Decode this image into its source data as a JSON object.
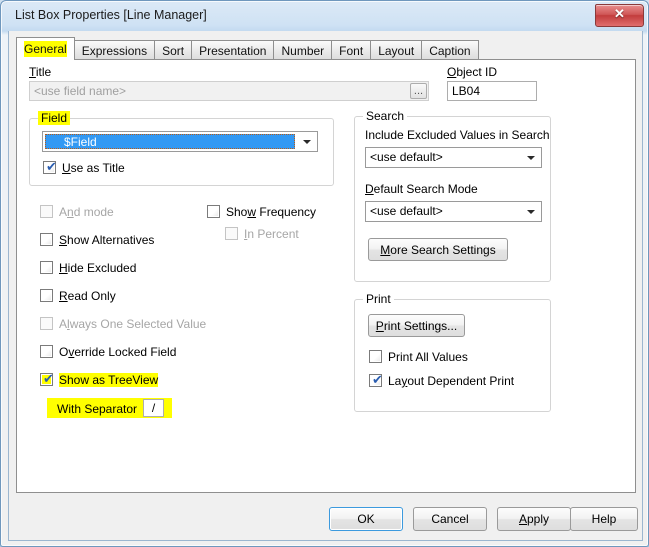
{
  "window": {
    "title": "List Box Properties [Line Manager]",
    "close_label": "✕",
    "close_icon": "close-icon"
  },
  "tabs": [
    {
      "label": "General",
      "active": true,
      "highlighted": true
    },
    {
      "label": "Expressions",
      "active": false,
      "highlighted": false
    },
    {
      "label": "Sort",
      "active": false,
      "highlighted": false
    },
    {
      "label": "Presentation",
      "active": false,
      "highlighted": false
    },
    {
      "label": "Number",
      "active": false,
      "highlighted": false
    },
    {
      "label": "Font",
      "active": false,
      "highlighted": false
    },
    {
      "label": "Layout",
      "active": false,
      "highlighted": false
    },
    {
      "label": "Caption",
      "active": false,
      "highlighted": false
    }
  ],
  "general": {
    "title_label": "Title",
    "title_value": "",
    "title_placeholder": "<use field name>",
    "title_browse_label": "...",
    "object_id_label": "Object ID",
    "object_id_value": "LB04",
    "field_group_label": "Field",
    "field_value": "$Field",
    "use_as_title_label": "Use as Title",
    "checkboxes": [
      {
        "name": "and-mode",
        "label": "And mode",
        "checked": false,
        "enabled": false,
        "highlighted": false
      },
      {
        "name": "show-alternatives",
        "label": "Show Alternatives",
        "checked": false,
        "enabled": true,
        "highlighted": false
      },
      {
        "name": "hide-excluded",
        "label": "Hide Excluded",
        "checked": false,
        "enabled": true,
        "highlighted": false
      },
      {
        "name": "read-only",
        "label": "Read Only",
        "checked": false,
        "enabled": true,
        "highlighted": false
      },
      {
        "name": "always-one-selected",
        "label": "Always One Selected Value",
        "checked": false,
        "enabled": false,
        "highlighted": false
      },
      {
        "name": "override-locked-field",
        "label": "Override Locked Field",
        "checked": false,
        "enabled": true,
        "highlighted": false
      },
      {
        "name": "show-as-treeview",
        "label": "Show as TreeView",
        "checked": true,
        "enabled": true,
        "highlighted": true
      }
    ],
    "show_frequency_label": "Show Frequency",
    "in_percent_label": "In Percent",
    "with_separator_label": "With Separator",
    "separator_value": "/"
  },
  "search": {
    "group_label": "Search",
    "include_excluded_label": "Include Excluded Values in Search",
    "include_excluded_value": "<use default>",
    "default_search_mode_label": "Default Search Mode",
    "default_search_mode_value": "<use default>",
    "more_settings_label": "More Search Settings"
  },
  "print": {
    "group_label": "Print",
    "print_settings_label": "Print Settings...",
    "print_all_values_label": "Print All Values",
    "layout_dependent_label": "Layout Dependent Print"
  },
  "footer": {
    "ok_label": "OK",
    "cancel_label": "Cancel",
    "apply_label": "Apply",
    "help_label": "Help"
  },
  "colors": {
    "highlight": "#ffff00",
    "selection_blue": "#3399f3",
    "accent_focus": "#3c9ade",
    "close_red": "#c23c3c"
  }
}
